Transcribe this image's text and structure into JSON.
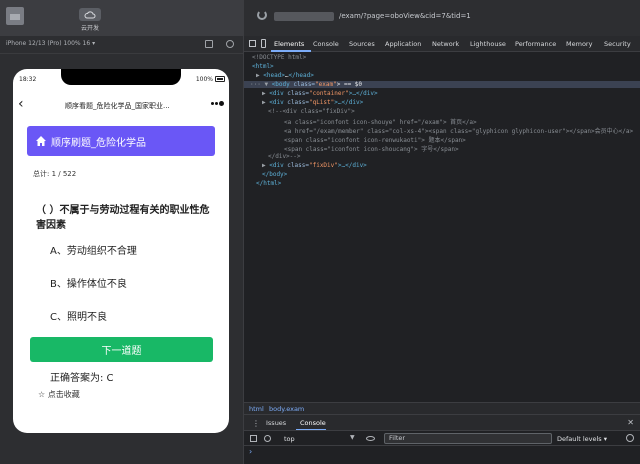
{
  "left": {
    "cloud_label": "云开发",
    "device_name": "iPhone 12/13 (Pro) 100% 16 ▾",
    "phone": {
      "time": "18:32",
      "battery": "100%",
      "nav_title": "顺序看题_危险化学品_国家职业...",
      "header": "顺序刷题_危险化学品",
      "total": "总计: 1 / 522",
      "question": "（ ）不属于与劳动过程有关的职业性危害因素",
      "options": [
        "A、劳动组织不合理",
        "B、操作体位不良",
        "C、照明不良"
      ],
      "next_button": "下一道题",
      "answer": "正确答案为: C",
      "favorite": "☆ 点击收藏"
    }
  },
  "devtools": {
    "url": "/exam/?page=oboView&cid=7&tid=1",
    "tabs": [
      "Elements",
      "Console",
      "Sources",
      "Application",
      "Network",
      "Lighthouse",
      "Performance",
      "Memory",
      "Security"
    ],
    "dom": {
      "l0": "<!DOCTYPE html>",
      "l1": "<html>",
      "l2_tag": "<head>",
      "l2_mid": "…",
      "l2_end": "</head>",
      "l3_pre": "<body ",
      "l3_attr": "class=",
      "l3_val": "\"exam\"",
      "l3_post": "> == $0",
      "l4_pre": "<div ",
      "l4_attr": "class=",
      "l4_val": "\"container\"",
      "l4_post": ">…</div>",
      "l5_pre": "<div ",
      "l5_attr": "class=",
      "l5_val": "\"qList\"",
      "l5_post": ">…</div>",
      "l6": "<!--<div class=\"fixDiv\">",
      "l7": "<a class=\"iconfont icon-shouye\" href=\"/exam\"> 首页</a>",
      "l8": "<a href=\"/exam/member\" class=\"col-xs-4\"><span class=\"glyphicon glyphicon-user\"></span>会员中心</a>",
      "l9": "<span class=\"iconfont icon-renwukaoti\"> 题本</span>",
      "l10": "<span class=\"iconfont icon-shoucang\"> 字号</span>",
      "l11": "</div>-->",
      "l12_pre": "<div ",
      "l12_attr": "class=",
      "l12_val": "\"fixDiv\"",
      "l12_post": ">…</div>",
      "l13": "</body>",
      "l14": "</html>"
    },
    "breadcrumbs": [
      "html",
      "body.exam"
    ],
    "drawer_tabs": [
      "Issues",
      "Console"
    ],
    "console": {
      "context": "top",
      "filter_placeholder": "Filter",
      "levels": "Default levels ▾",
      "prompt": "›"
    }
  }
}
